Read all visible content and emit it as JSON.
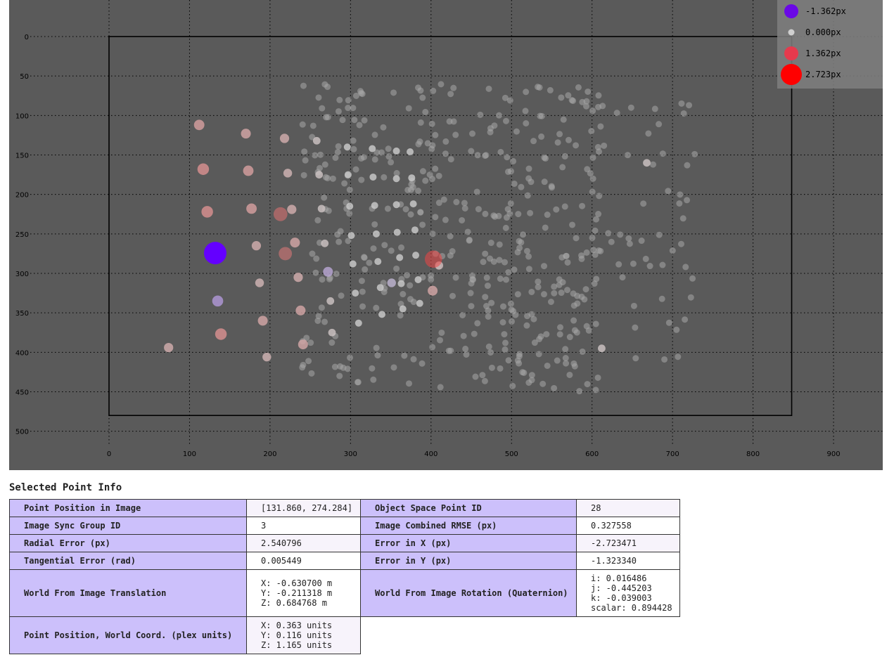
{
  "plot": {
    "x_ticks": [
      "0",
      "100",
      "200",
      "300",
      "400",
      "500",
      "600",
      "700",
      "800",
      "900"
    ],
    "y_ticks": [
      "0",
      "50",
      "100",
      "150",
      "200",
      "250",
      "300",
      "350",
      "400",
      "450",
      "500"
    ],
    "legend": [
      {
        "label": "-1.362px",
        "color": "#6a08e6"
      },
      {
        "label": "0.000px",
        "color": "#cfcfcf"
      },
      {
        "label": "1.362px",
        "color": "#e63a4d"
      },
      {
        "label": "2.723px",
        "color": "#ff0000"
      }
    ],
    "colors": {
      "background": "#5a5a5a",
      "grid": "#000000",
      "frame": "#000000",
      "legend_bg": "#7f7f7f"
    }
  },
  "chart_data": {
    "type": "scatter",
    "xlim": [
      0,
      940
    ],
    "ylim": [
      0,
      530
    ],
    "y_inverted": true,
    "image_extent": {
      "width": 848,
      "height": 480
    },
    "grid": true,
    "legend_position": "top-right",
    "color_scale": {
      "min": -2.723,
      "max": 2.723,
      "legend_values": [
        -1.362,
        0.0,
        1.362,
        2.723
      ]
    },
    "highlight_points": [
      {
        "x": 131.9,
        "y": 274.3,
        "error": -2.72
      },
      {
        "x": 213,
        "y": 225,
        "error": 1.2
      },
      {
        "x": 219,
        "y": 275,
        "error": 1.1
      },
      {
        "x": 403,
        "y": 282,
        "error": 1.8
      }
    ],
    "points": [
      {
        "x": 112,
        "y": 112,
        "error": 0.6
      },
      {
        "x": 117,
        "y": 168,
        "error": 0.8
      },
      {
        "x": 122,
        "y": 222,
        "error": 0.8
      },
      {
        "x": 135,
        "y": 335,
        "error": -0.7
      },
      {
        "x": 139,
        "y": 377,
        "error": 0.8
      },
      {
        "x": 74,
        "y": 394,
        "error": 0.4
      },
      {
        "x": 170,
        "y": 123,
        "error": 0.5
      },
      {
        "x": 173,
        "y": 170,
        "error": 0.6
      },
      {
        "x": 177,
        "y": 218,
        "error": 0.6
      },
      {
        "x": 183,
        "y": 265,
        "error": 0.4
      },
      {
        "x": 187,
        "y": 312,
        "error": 0.3
      },
      {
        "x": 191,
        "y": 360,
        "error": 0.5
      },
      {
        "x": 196,
        "y": 406,
        "error": 0.3
      },
      {
        "x": 218,
        "y": 129,
        "error": 0.4
      },
      {
        "x": 222,
        "y": 173,
        "error": 0.3
      },
      {
        "x": 227,
        "y": 219,
        "error": 0.4
      },
      {
        "x": 231,
        "y": 261,
        "error": 0.5
      },
      {
        "x": 235,
        "y": 305,
        "error": 0.4
      },
      {
        "x": 238,
        "y": 347,
        "error": 0.5
      },
      {
        "x": 241,
        "y": 390,
        "error": 0.5
      },
      {
        "x": 272,
        "y": 298,
        "error": -0.5
      },
      {
        "x": 268,
        "y": 262,
        "error": 0.1
      },
      {
        "x": 264,
        "y": 218,
        "error": 0.1
      },
      {
        "x": 261,
        "y": 175,
        "error": 0.1
      },
      {
        "x": 258,
        "y": 132,
        "error": 0.1
      },
      {
        "x": 275,
        "y": 335,
        "error": 0.1
      },
      {
        "x": 277,
        "y": 375,
        "error": 0.1
      },
      {
        "x": 296,
        "y": 140,
        "error": 0.0
      },
      {
        "x": 297,
        "y": 175,
        "error": 0.0
      },
      {
        "x": 299,
        "y": 215,
        "error": 0.0
      },
      {
        "x": 301,
        "y": 252,
        "error": 0.0
      },
      {
        "x": 303,
        "y": 288,
        "error": 0.0
      },
      {
        "x": 306,
        "y": 325,
        "error": 0.0
      },
      {
        "x": 310,
        "y": 363,
        "error": 0.0
      },
      {
        "x": 327,
        "y": 142,
        "error": 0.0
      },
      {
        "x": 328,
        "y": 178,
        "error": 0.0
      },
      {
        "x": 330,
        "y": 214,
        "error": 0.0
      },
      {
        "x": 332,
        "y": 250,
        "error": 0.0
      },
      {
        "x": 334,
        "y": 285,
        "error": 0.0
      },
      {
        "x": 337,
        "y": 318,
        "error": 0.0
      },
      {
        "x": 339,
        "y": 352,
        "error": 0.0
      },
      {
        "x": 351,
        "y": 312,
        "error": -0.3
      },
      {
        "x": 357,
        "y": 145,
        "error": 0.0
      },
      {
        "x": 357,
        "y": 180,
        "error": 0.0
      },
      {
        "x": 357,
        "y": 213,
        "error": 0.0
      },
      {
        "x": 358,
        "y": 248,
        "error": 0.0
      },
      {
        "x": 361,
        "y": 280,
        "error": 0.0
      },
      {
        "x": 363,
        "y": 313,
        "error": 0.0
      },
      {
        "x": 365,
        "y": 345,
        "error": 0.0
      },
      {
        "x": 374,
        "y": 146,
        "error": 0.0
      },
      {
        "x": 376,
        "y": 179,
        "error": 0.0
      },
      {
        "x": 378,
        "y": 212,
        "error": 0.0
      },
      {
        "x": 380,
        "y": 245,
        "error": 0.0
      },
      {
        "x": 381,
        "y": 277,
        "error": 0.0
      },
      {
        "x": 384,
        "y": 308,
        "error": 0.0
      },
      {
        "x": 386,
        "y": 338,
        "error": 0.0
      },
      {
        "x": 402,
        "y": 322,
        "error": 0.5
      },
      {
        "x": 410,
        "y": 290,
        "error": 0.2
      },
      {
        "x": 612,
        "y": 395,
        "error": 0.1
      },
      {
        "x": 668,
        "y": 160,
        "error": 0.1
      }
    ]
  }
}
